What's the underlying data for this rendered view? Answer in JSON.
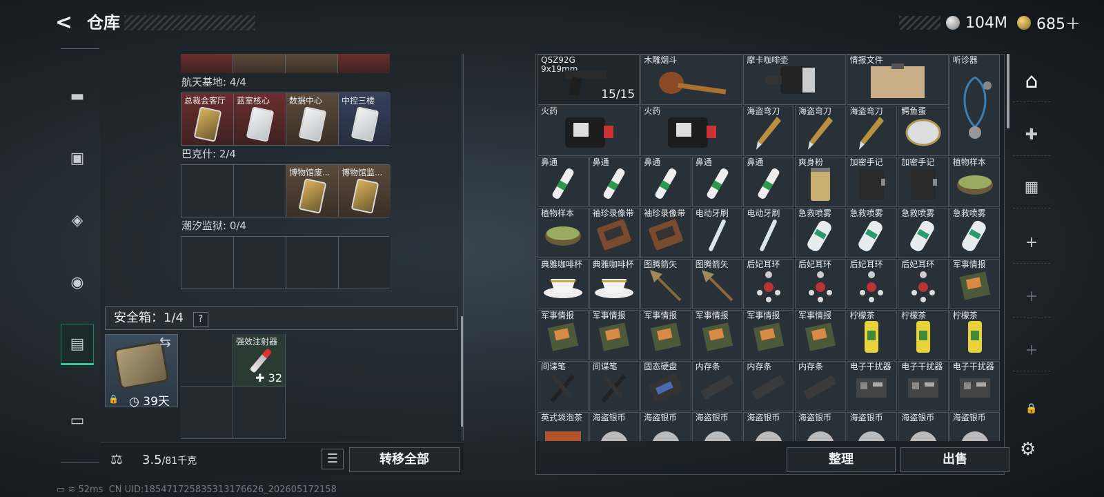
{
  "header": {
    "title": "仓库",
    "back": "<"
  },
  "currency": [
    {
      "icon": "silver-coin-icon",
      "value": "104M"
    },
    {
      "icon": "gold-coin-icon",
      "value": "685＋"
    }
  ],
  "left_nav": [
    {
      "name": "weapon",
      "icon": "▬"
    },
    {
      "name": "armor",
      "icon": "▣"
    },
    {
      "name": "backpack",
      "icon": "◈"
    },
    {
      "name": "bag",
      "icon": "◉"
    },
    {
      "name": "safe-box",
      "icon": "▤",
      "active": true
    },
    {
      "name": "toolbox",
      "icon": "▭"
    }
  ],
  "groups": [
    {
      "label": "航天基地: 4/4",
      "cells": [
        {
          "name": "总裁会客厅",
          "style": "red",
          "card": "gold"
        },
        {
          "name": "蓝室核心",
          "style": "red",
          "card": "white"
        },
        {
          "name": "数据中心",
          "style": "brown",
          "card": "white"
        },
        {
          "name": "中控三楼",
          "style": "blue",
          "card": "white"
        }
      ]
    },
    {
      "label": "巴克什: 2/4",
      "cells": [
        {
          "name": "",
          "style": "empty"
        },
        {
          "name": "",
          "style": "empty"
        },
        {
          "name": "博物馆废...",
          "style": "brown",
          "card": "gold"
        },
        {
          "name": "博物馆监...",
          "style": "brown",
          "card": "gold"
        }
      ]
    },
    {
      "label": "潮汐监狱: 0/4",
      "cells": [
        {
          "name": "",
          "style": "empty"
        },
        {
          "name": "",
          "style": "empty"
        },
        {
          "name": "",
          "style": "empty"
        },
        {
          "name": "",
          "style": "empty"
        }
      ]
    }
  ],
  "safe_box": {
    "label": "安全箱：1/4",
    "help": "?",
    "days": "39天",
    "item_name": "强效注射器",
    "item_count": "✚ 32"
  },
  "weight": {
    "value": "3.5",
    "unit": "/81千克"
  },
  "buttons": {
    "transfer_all": "转移全部",
    "sort": "整理",
    "sell": "出售",
    "list": "☰"
  },
  "right_nav": [
    {
      "name": "helmet",
      "icon": "⌂"
    },
    {
      "name": "medkit",
      "icon": "✚"
    },
    {
      "name": "cassette",
      "icon": "▦"
    },
    {
      "name": "add",
      "icon": "+"
    },
    {
      "name": "add-2",
      "icon": "+"
    },
    {
      "name": "add-3",
      "icon": "+"
    },
    {
      "name": "lock",
      "icon": "🔒"
    }
  ],
  "items": [
    {
      "name": "QSZ92G\n9x19mm",
      "c": 0,
      "r": 0,
      "w": 2,
      "h": 1,
      "icon": "pistol",
      "count": "15/15"
    },
    {
      "name": "木雕烟斗",
      "c": 2,
      "r": 0,
      "w": 2,
      "h": 1,
      "icon": "pipe"
    },
    {
      "name": "摩卡咖啡壶",
      "c": 4,
      "r": 0,
      "w": 2,
      "h": 1,
      "icon": "pot"
    },
    {
      "name": "情报文件",
      "c": 6,
      "r": 0,
      "w": 2,
      "h": 1,
      "icon": "clipboard"
    },
    {
      "name": "听诊器",
      "c": 8,
      "r": 0,
      "w": 1,
      "h": 2,
      "icon": "stethoscope"
    },
    {
      "name": "火药",
      "c": 0,
      "r": 1,
      "w": 2,
      "h": 1,
      "icon": "powder"
    },
    {
      "name": "火药",
      "c": 2,
      "r": 1,
      "w": 2,
      "h": 1,
      "icon": "powder"
    },
    {
      "name": "海盗弯刀",
      "c": 4,
      "r": 1,
      "icon": "knife"
    },
    {
      "name": "海盗弯刀",
      "c": 5,
      "r": 1,
      "icon": "knife"
    },
    {
      "name": "海盗弯刀",
      "c": 6,
      "r": 1,
      "icon": "knife"
    },
    {
      "name": "鳄鱼蛋",
      "c": 7,
      "r": 1,
      "icon": "egg"
    },
    {
      "name": "鼻通",
      "c": 0,
      "r": 2,
      "icon": "tube"
    },
    {
      "name": "鼻通",
      "c": 1,
      "r": 2,
      "icon": "tube"
    },
    {
      "name": "鼻通",
      "c": 2,
      "r": 2,
      "icon": "tube"
    },
    {
      "name": "鼻通",
      "c": 3,
      "r": 2,
      "icon": "tube"
    },
    {
      "name": "鼻通",
      "c": 4,
      "r": 2,
      "icon": "tube"
    },
    {
      "name": "爽身粉",
      "c": 5,
      "r": 2,
      "icon": "can"
    },
    {
      "name": "加密手记",
      "c": 6,
      "r": 2,
      "icon": "notebook"
    },
    {
      "name": "加密手记",
      "c": 7,
      "r": 2,
      "icon": "notebook"
    },
    {
      "name": "植物样本",
      "c": 8,
      "r": 2,
      "icon": "dish"
    },
    {
      "name": "植物样本",
      "c": 0,
      "r": 3,
      "icon": "dish"
    },
    {
      "name": "袖珍录像带",
      "c": 1,
      "r": 3,
      "icon": "tape"
    },
    {
      "name": "袖珍录像带",
      "c": 2,
      "r": 3,
      "icon": "tape"
    },
    {
      "name": "电动牙刷",
      "c": 3,
      "r": 3,
      "icon": "brush"
    },
    {
      "name": "电动牙刷",
      "c": 4,
      "r": 3,
      "icon": "brush"
    },
    {
      "name": "急救喷雾",
      "c": 5,
      "r": 3,
      "icon": "spray"
    },
    {
      "name": "急救喷雾",
      "c": 6,
      "r": 3,
      "icon": "spray"
    },
    {
      "name": "急救喷雾",
      "c": 7,
      "r": 3,
      "icon": "spray"
    },
    {
      "name": "急救喷雾",
      "c": 8,
      "r": 3,
      "icon": "spray"
    },
    {
      "name": "典雅咖啡杯",
      "c": 0,
      "r": 4,
      "icon": "cup"
    },
    {
      "name": "典雅咖啡杯",
      "c": 1,
      "r": 4,
      "icon": "cup"
    },
    {
      "name": "图腾箭矢",
      "c": 2,
      "r": 4,
      "icon": "arrow"
    },
    {
      "name": "图腾箭矢",
      "c": 3,
      "r": 4,
      "icon": "arrow"
    },
    {
      "name": "后妃耳环",
      "c": 4,
      "r": 4,
      "icon": "earring"
    },
    {
      "name": "后妃耳环",
      "c": 5,
      "r": 4,
      "icon": "earring"
    },
    {
      "name": "后妃耳环",
      "c": 6,
      "r": 4,
      "icon": "earring"
    },
    {
      "name": "后妃耳环",
      "c": 7,
      "r": 4,
      "icon": "earring"
    },
    {
      "name": "军事情报",
      "c": 8,
      "r": 4,
      "icon": "board"
    },
    {
      "name": "军事情报",
      "c": 0,
      "r": 5,
      "icon": "board"
    },
    {
      "name": "军事情报",
      "c": 1,
      "r": 5,
      "icon": "board"
    },
    {
      "name": "军事情报",
      "c": 2,
      "r": 5,
      "icon": "board"
    },
    {
      "name": "军事情报",
      "c": 3,
      "r": 5,
      "icon": "board"
    },
    {
      "name": "军事情报",
      "c": 4,
      "r": 5,
      "icon": "board"
    },
    {
      "name": "军事情报",
      "c": 5,
      "r": 5,
      "icon": "board"
    },
    {
      "name": "柠檬茶",
      "c": 6,
      "r": 5,
      "icon": "drink"
    },
    {
      "name": "柠檬茶",
      "c": 7,
      "r": 5,
      "icon": "drink"
    },
    {
      "name": "柠檬茶",
      "c": 8,
      "r": 5,
      "icon": "drink"
    },
    {
      "name": "间谍笔",
      "c": 0,
      "r": 6,
      "icon": "pen"
    },
    {
      "name": "间谍笔",
      "c": 1,
      "r": 6,
      "icon": "pen"
    },
    {
      "name": "固态硬盘",
      "c": 2,
      "r": 6,
      "icon": "ssd"
    },
    {
      "name": "内存条",
      "c": 3,
      "r": 6,
      "icon": "ram"
    },
    {
      "name": "内存条",
      "c": 4,
      "r": 6,
      "icon": "ram"
    },
    {
      "name": "内存条",
      "c": 5,
      "r": 6,
      "icon": "ram"
    },
    {
      "name": "电子干扰器",
      "c": 6,
      "r": 6,
      "icon": "jammer"
    },
    {
      "name": "电子干扰器",
      "c": 7,
      "r": 6,
      "icon": "jammer"
    },
    {
      "name": "电子干扰器",
      "c": 8,
      "r": 6,
      "icon": "jammer"
    },
    {
      "name": "英式袋泡茶",
      "c": 0,
      "r": 7,
      "icon": "teabox"
    },
    {
      "name": "海盗银币",
      "c": 1,
      "r": 7,
      "icon": "coin"
    },
    {
      "name": "海盗银币",
      "c": 2,
      "r": 7,
      "icon": "coin"
    },
    {
      "name": "海盗银币",
      "c": 3,
      "r": 7,
      "icon": "coin"
    },
    {
      "name": "海盗银币",
      "c": 4,
      "r": 7,
      "icon": "coin"
    },
    {
      "name": "海盗银币",
      "c": 5,
      "r": 7,
      "icon": "coin"
    },
    {
      "name": "海盗银币",
      "c": 6,
      "r": 7,
      "icon": "coin"
    },
    {
      "name": "海盗银币",
      "c": 7,
      "r": 7,
      "icon": "coin"
    },
    {
      "name": "海盗银币",
      "c": 8,
      "r": 7,
      "icon": "coin"
    }
  ],
  "status_bar": {
    "ping": "52ms",
    "uid": "CN UID:18547172583531317662​6_202605172158"
  }
}
